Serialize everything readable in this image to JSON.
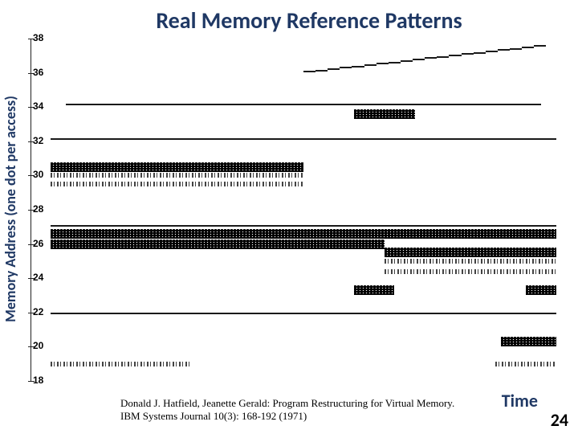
{
  "title": "Real Memory Reference Patterns",
  "ylabel": "Memory Address (one dot per access)",
  "xlabel": "Time",
  "citation_line1": "Donald J. Hatfield, Jeanette Gerald: Program Restructuring for Virtual Memory.",
  "citation_line2": "IBM Systems Journal 10(3): 168-192 (1971)",
  "page_number": "24",
  "chart_data": {
    "type": "scatter",
    "title": "Real Memory Reference Patterns",
    "xlabel": "Time",
    "ylabel": "Memory Address (one dot per access)",
    "ylim": [
      18,
      38
    ],
    "yticks": [
      18,
      20,
      22,
      24,
      26,
      28,
      30,
      32,
      34,
      36,
      38
    ],
    "note": "Dense scatter of memory accesses over time; values are approximate band extents (address, time_start%, time_end%, density).",
    "bands": [
      {
        "addr": 34.2,
        "t0": 3,
        "t1": 97,
        "density": "line"
      },
      {
        "addr": 33.6,
        "t0": 60,
        "t1": 72,
        "density": "dense"
      },
      {
        "addr": 32.2,
        "t0": 0,
        "t1": 100,
        "density": "line"
      },
      {
        "addr": 30.5,
        "t0": 0,
        "t1": 50,
        "density": "dense"
      },
      {
        "addr": 30.0,
        "t0": 0,
        "t1": 50,
        "density": "noise"
      },
      {
        "addr": 29.5,
        "t0": 0,
        "t1": 50,
        "density": "noise"
      },
      {
        "addr": 27.1,
        "t0": 0,
        "t1": 100,
        "density": "line"
      },
      {
        "addr": 26.6,
        "t0": 0,
        "t1": 100,
        "density": "dense"
      },
      {
        "addr": 26.0,
        "t0": 0,
        "t1": 66,
        "density": "dense"
      },
      {
        "addr": 25.5,
        "t0": 66,
        "t1": 100,
        "density": "dense"
      },
      {
        "addr": 25.0,
        "t0": 66,
        "t1": 100,
        "density": "noise"
      },
      {
        "addr": 24.4,
        "t0": 66,
        "t1": 100,
        "density": "noise"
      },
      {
        "addr": 23.3,
        "t0": 60,
        "t1": 68,
        "density": "dense"
      },
      {
        "addr": 23.3,
        "t0": 94,
        "t1": 100,
        "density": "dense"
      },
      {
        "addr": 22.0,
        "t0": 0,
        "t1": 100,
        "density": "line"
      },
      {
        "addr": 20.3,
        "t0": 89,
        "t1": 100,
        "density": "dense"
      },
      {
        "addr": 19.0,
        "t0": 0,
        "t1": 28,
        "density": "noise"
      },
      {
        "addr": 19.0,
        "t0": 88,
        "t1": 100,
        "density": "noise"
      },
      {
        "addr": 36.1,
        "t0": 50,
        "t1": 98,
        "density": "slope"
      }
    ]
  }
}
